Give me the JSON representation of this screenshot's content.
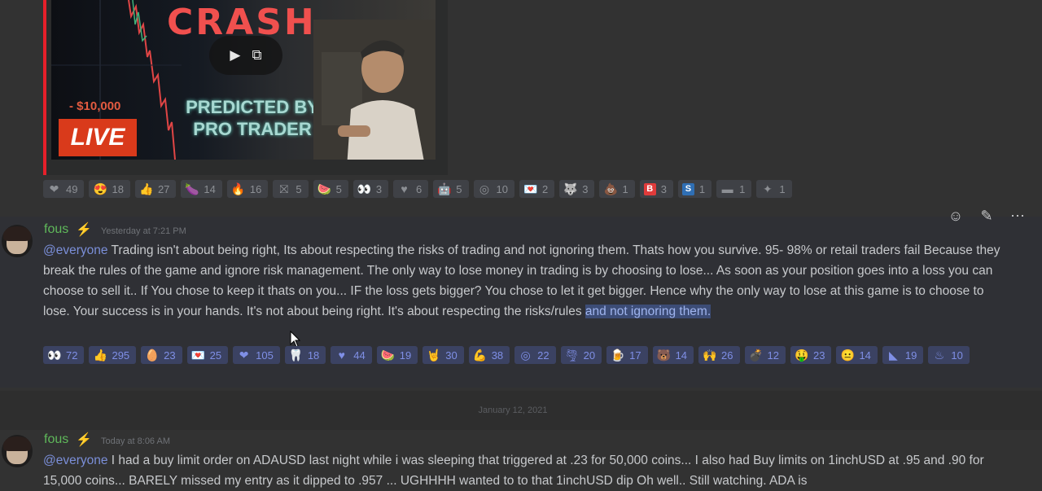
{
  "embed": {
    "headline": "CRASH",
    "amount": "- $10,000",
    "live_label": "LIVE",
    "caption_line1": "PREDICTED BY",
    "caption_line2": "PRO TRADER"
  },
  "top_reactions": [
    {
      "icon": "red-heart-icon",
      "glyph": "❤",
      "count": "49"
    },
    {
      "icon": "heart-eyes-icon",
      "glyph": "😍",
      "count": "18"
    },
    {
      "icon": "thumbs-up-icon",
      "glyph": "👍",
      "count": "27"
    },
    {
      "icon": "eggplant-icon",
      "glyph": "🍆",
      "count": "14"
    },
    {
      "icon": "fire-icon",
      "glyph": "🔥",
      "count": "16"
    },
    {
      "icon": "no-entry-icon",
      "glyph": "⛝",
      "count": "5"
    },
    {
      "icon": "watermelon-icon",
      "glyph": "🍉",
      "count": "5"
    },
    {
      "icon": "eyes-icon",
      "glyph": "👀",
      "count": "3"
    },
    {
      "icon": "white-heart-icon",
      "glyph": "♥",
      "count": "6"
    },
    {
      "icon": "robot-icon",
      "glyph": "🤖",
      "count": "5"
    },
    {
      "icon": "target-icon",
      "glyph": "◎",
      "count": "10"
    },
    {
      "icon": "love-letter-icon",
      "glyph": "💌",
      "count": "2"
    },
    {
      "icon": "wolf-icon",
      "glyph": "🐺",
      "count": "3"
    },
    {
      "icon": "poop-icon",
      "glyph": "💩",
      "count": "1"
    },
    {
      "icon": "letter-b-icon",
      "glyph": "B",
      "box": "#e03b3b",
      "count": "3"
    },
    {
      "icon": "letter-s-icon",
      "glyph": "S",
      "box": "#2f6fb5",
      "count": "1"
    },
    {
      "icon": "germany-flag-icon",
      "glyph": "▬",
      "count": "1"
    },
    {
      "icon": "australia-flag-icon",
      "glyph": "✦",
      "count": "1"
    }
  ],
  "message1": {
    "username": "fous",
    "timestamp": "Yesterday at 7:21 PM",
    "mention": "@everyone",
    "text_main": " Trading isn't about being right, Its about respecting the risks of trading and not ignoring them. Thats how you survive. 95- 98% or retail traders fail Because they break the rules of the game and ignore risk management.  The only way to lose money in trading is by choosing to lose... As soon as your position goes into a loss you can choose to sell it.. If You chose to keep it thats on you... IF the loss gets bigger? You chose to let it get bigger. Hence why the only way to lose at this game is to choose to lose. Your success is in your hands. It's not about being right. It's about respecting the risks/rules ",
    "text_selected": "and not ignoring them.",
    "reactions": [
      {
        "icon": "eyes-icon",
        "glyph": "👀",
        "count": "72",
        "me": true
      },
      {
        "icon": "thumbs-up-icon",
        "glyph": "👍",
        "count": "295",
        "me": true
      },
      {
        "icon": "egg-icon",
        "glyph": "🥚",
        "count": "23",
        "me": true
      },
      {
        "icon": "love-letter-icon",
        "glyph": "💌",
        "count": "25",
        "me": true
      },
      {
        "icon": "red-heart-icon",
        "glyph": "❤",
        "count": "105",
        "me": true
      },
      {
        "icon": "tooth-icon",
        "glyph": "🦷",
        "count": "18",
        "me": true
      },
      {
        "icon": "heart-icon",
        "glyph": "♥",
        "count": "44",
        "me": true
      },
      {
        "icon": "watermelon-icon",
        "glyph": "🍉",
        "count": "19",
        "me": true
      },
      {
        "icon": "rock-on-icon",
        "glyph": "🤘",
        "count": "30",
        "me": true
      },
      {
        "icon": "muscle-icon",
        "glyph": "💪",
        "count": "38",
        "me": true
      },
      {
        "icon": "target-icon",
        "glyph": "◎",
        "count": "22",
        "me": true
      },
      {
        "icon": "tornado-icon",
        "glyph": "🌪",
        "count": "20",
        "me": true
      },
      {
        "icon": "beer-icon",
        "glyph": "🍺",
        "count": "17",
        "me": true
      },
      {
        "icon": "bear-icon",
        "glyph": "🐻",
        "count": "14",
        "me": true
      },
      {
        "icon": "raised-hands-icon",
        "glyph": "🙌",
        "count": "26",
        "me": true
      },
      {
        "icon": "bomb-icon",
        "glyph": "💣",
        "count": "12",
        "me": true
      },
      {
        "icon": "money-mouth-icon",
        "glyph": "🤑",
        "count": "23",
        "me": true
      },
      {
        "icon": "neutral-face-icon",
        "glyph": "😐",
        "count": "14",
        "me": true
      },
      {
        "icon": "philippines-flag-icon",
        "glyph": "◣",
        "count": "19",
        "me": true
      },
      {
        "icon": "hot-tub-icon",
        "glyph": "♨",
        "count": "10",
        "me": true
      }
    ]
  },
  "divider_date": "January 12, 2021",
  "message2": {
    "username": "fous",
    "timestamp": "Today at 8:06 AM",
    "mention": "@everyone",
    "text_main": " I had a buy limit order on ADAUSD last night while i was sleeping that triggered at .23 for 50,000 coins... I also had Buy limits on 1inchUSD at .95 and .90 for 15,000 coins... BARELY missed my entry as it dipped to .957 ... UGHHHH wanted to to that 1inchUSD dip Oh well.. Still watching. ADA is"
  },
  "actions": {
    "add_reaction_glyph": "☺",
    "edit_glyph": "✎",
    "more_glyph": "⋯"
  }
}
